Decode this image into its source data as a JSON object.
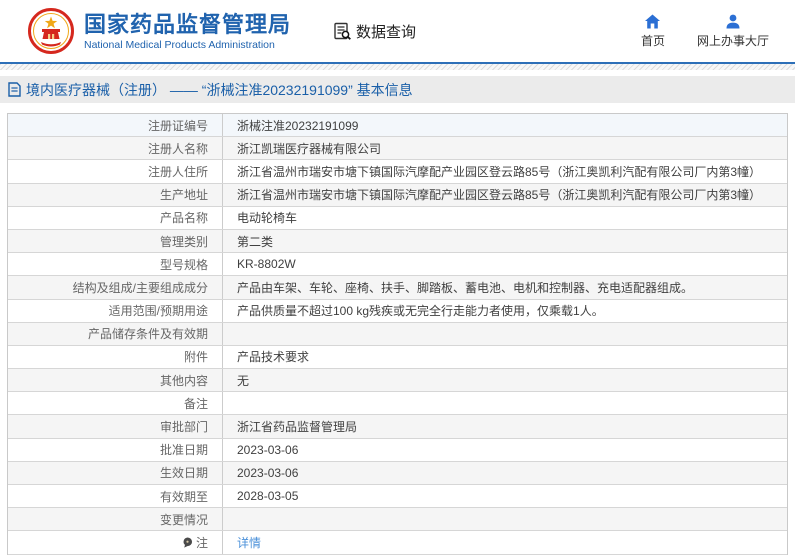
{
  "header": {
    "agency_cn": "国家药品监督管理局",
    "agency_en": "National Medical Products Administration",
    "query_label": "数据查询",
    "nav": {
      "home": "首页",
      "hall": "网上办事大厅"
    }
  },
  "breadcrumb": {
    "text": "境内医疗器械（注册） —— “浙械注准20232191099” 基本信息"
  },
  "table": {
    "rows": [
      {
        "label": "注册证编号",
        "value": "浙械注准20232191099",
        "shade": "hover"
      },
      {
        "label": "注册人名称",
        "value": "浙江凯瑞医疗器械有限公司",
        "shade": "gray"
      },
      {
        "label": "注册人住所",
        "value": "浙江省温州市瑞安市塘下镇国际汽摩配产业园区登云路85号（浙江奥凯利汽配有限公司厂内第3幢）",
        "shade": "white"
      },
      {
        "label": "生产地址",
        "value": "浙江省温州市瑞安市塘下镇国际汽摩配产业园区登云路85号（浙江奥凯利汽配有限公司厂内第3幢）",
        "shade": "gray"
      },
      {
        "label": "产品名称",
        "value": "电动轮椅车",
        "shade": "white"
      },
      {
        "label": "管理类别",
        "value": "第二类",
        "shade": "gray"
      },
      {
        "label": "型号规格",
        "value": "KR-8802W",
        "shade": "white"
      },
      {
        "label": "结构及组成/主要组成成分",
        "value": "产品由车架、车轮、座椅、扶手、脚踏板、蓄电池、电机和控制器、充电适配器组成。",
        "shade": "gray"
      },
      {
        "label": "适用范围/预期用途",
        "value": "产品供质量不超过100 kg残疾或无完全行走能力者使用，仅乘载1人。",
        "shade": "white"
      },
      {
        "label": "产品储存条件及有效期",
        "value": "",
        "shade": "gray"
      },
      {
        "label": "附件",
        "value": "产品技术要求",
        "shade": "white"
      },
      {
        "label": "其他内容",
        "value": "无",
        "shade": "gray"
      },
      {
        "label": "备注",
        "value": "",
        "shade": "white"
      },
      {
        "label": "审批部门",
        "value": "浙江省药品监督管理局",
        "shade": "gray"
      },
      {
        "label": "批准日期",
        "value": "2023-03-06",
        "shade": "white"
      },
      {
        "label": "生效日期",
        "value": "2023-03-06",
        "shade": "gray"
      },
      {
        "label": "有效期至",
        "value": "2028-03-05",
        "shade": "white"
      },
      {
        "label": "变更情况",
        "value": "",
        "shade": "gray"
      },
      {
        "label": "注",
        "value": "详情",
        "shade": "white",
        "label_icon": "note-icon",
        "link": true
      }
    ]
  },
  "colors": {
    "accent_blue": "#2063ae",
    "divider_blue": "#2d6fb7",
    "nav_icon_blue": "#2b6fd4",
    "breadcrumb_blue": "#1a5fa8",
    "link_blue": "#4a90d9",
    "emblem_red": "#d5281e",
    "emblem_gold": "#f0a818",
    "row_gray": "#f5f5f5",
    "row_hover": "#f3f7fb"
  }
}
